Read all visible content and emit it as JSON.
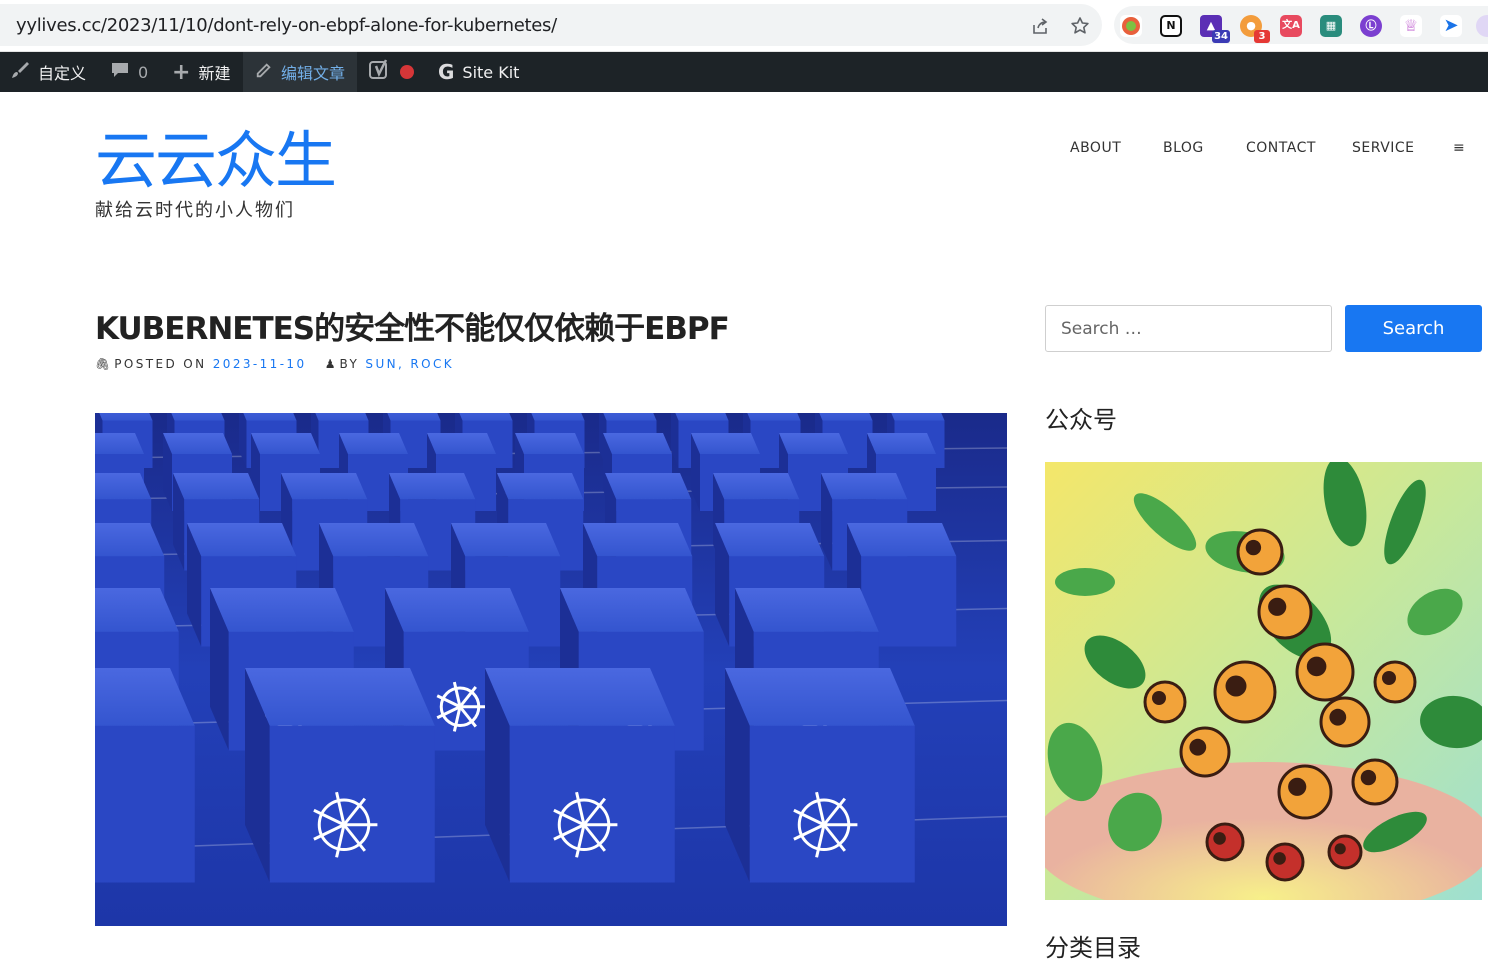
{
  "browser": {
    "url": "yylives.cc/2023/11/10/dont-rely-on-ebpf-alone-for-kubernetes/",
    "extensions": [
      {
        "name": "chrome-ext-orange",
        "badge": ""
      },
      {
        "name": "notion",
        "badge": ""
      },
      {
        "name": "ext-graduation",
        "badge": "34"
      },
      {
        "name": "ext-clouds",
        "badge": "3"
      },
      {
        "name": "ext-translate",
        "badge": ""
      },
      {
        "name": "ext-pattern",
        "badge": ""
      },
      {
        "name": "ext-purple-circle",
        "badge": ""
      },
      {
        "name": "ext-crown",
        "badge": ""
      },
      {
        "name": "ext-blue-arrow",
        "badge": ""
      }
    ]
  },
  "admin_bar": {
    "customize": "自定义",
    "comments_count": "0",
    "new": "新建",
    "edit_post": "编辑文章",
    "site_kit": "Site Kit"
  },
  "site": {
    "title": "云云众生",
    "tagline": "献给云时代的小人物们"
  },
  "nav": {
    "items": [
      "ABOUT",
      "BLOG",
      "CONTACT",
      "SERVICE"
    ],
    "menu_icon": "≡"
  },
  "post": {
    "title": "KUBERNETES的安全性不能仅仅依赖于EBPF",
    "posted_on_label": "POSTED ON",
    "date": "2023-11-10",
    "by_label": "BY",
    "author": "SUN, ROCK"
  },
  "sidebar": {
    "search_placeholder": "Search …",
    "search_button": "Search",
    "widget_wechat_title": "公众号",
    "widget_category_title": "分类目录"
  },
  "colors": {
    "accent": "#1877f2",
    "admin_bar": "#1d2327",
    "hero_blue": "#1b2f9b"
  }
}
